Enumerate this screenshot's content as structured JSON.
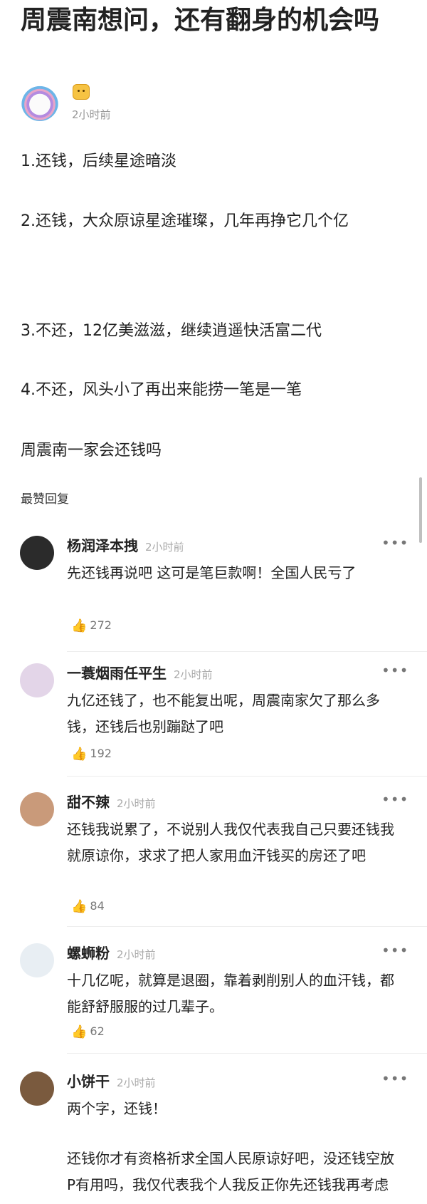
{
  "post": {
    "title": "周震南想问，还有翻身的机会吗",
    "author_time": "2小时前",
    "paragraphs": [
      "1.还钱，后续星途暗淡",
      "2.还钱，大众原谅星途璀璨，几年再挣它几个亿",
      "3.不还，12亿美滋滋，继续逍遥快活富二代",
      "4.不还，风头小了再出来能捞一笔是一笔",
      "周震南一家会还钱吗"
    ]
  },
  "section_label": "最赞回复",
  "comments": [
    {
      "name": "杨润泽本拽",
      "time": "2小时前",
      "text": "先还钱再说吧 这可是笔巨款啊！全国人民亏了",
      "likes": "272",
      "avatar_color": "#2b2b2b"
    },
    {
      "name": "一蓑烟雨任平生",
      "time": "2小时前",
      "text": "九亿还钱了，也不能复出呢，周震南家欠了那么多钱，还钱后也别蹦跶了吧",
      "likes": "192",
      "avatar_color": "#e3d5e8"
    },
    {
      "name": "甜不辣",
      "time": "2小时前",
      "text": "还钱我说累了，不说别人我仅代表我自己只要还钱我就原谅你，求求了把人家用血汗钱买的房还了吧",
      "likes": "84",
      "avatar_color": "#c99a7a"
    },
    {
      "name": "螺蛳粉",
      "time": "2小时前",
      "text": "十几亿呢，就算是退圈，靠着剥削别人的血汗钱，都能舒舒服服的过几辈子。",
      "likes": "62",
      "avatar_color": "#e8eef3"
    },
    {
      "name": "小饼干",
      "time": "2小时前",
      "text": "两个字，还钱！",
      "text2": "还钱你才有资格祈求全国人民原谅好吧，没还钱空放P有用吗，我仅代表我个人我反正你先还钱我再考虑原不原谅你",
      "avatar_color": "#7a5a3e"
    }
  ],
  "icons": {
    "more": "more-dots-icon",
    "like": "thumb-up-icon",
    "badge": "tiger-badge-icon"
  }
}
